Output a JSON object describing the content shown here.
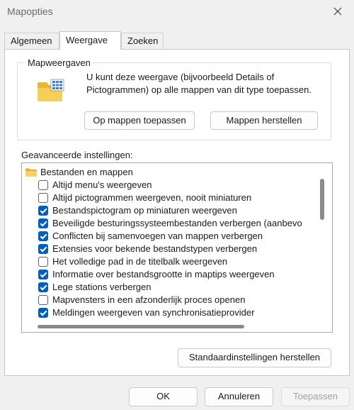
{
  "window": {
    "title": "Mapopties"
  },
  "tabs": [
    {
      "label": "Algemeen",
      "active": false
    },
    {
      "label": "Weergave",
      "active": true
    },
    {
      "label": "Zoeken",
      "active": false
    }
  ],
  "folder_views": {
    "title": "Mapweergaven",
    "description": "U kunt deze weergave (bijvoorbeeld Details of Pictogrammen) op alle mappen van dit type toepassen.",
    "apply_label": "Op mappen toepassen",
    "reset_label": "Mappen herstellen",
    "icon": "folder-icon"
  },
  "advanced": {
    "label": "Geavanceerde instellingen:",
    "root": {
      "label": "Bestanden en mappen",
      "icon": "folder-icon"
    },
    "items": [
      {
        "label": "Altijd menu's weergeven",
        "checked": false
      },
      {
        "label": "Altijd pictogrammen weergeven, nooit miniaturen",
        "checked": false
      },
      {
        "label": "Bestandspictogram op miniaturen weergeven",
        "checked": true
      },
      {
        "label": "Beveiligde besturingssysteembestanden verbergen (aanbevo",
        "checked": true
      },
      {
        "label": "Conflicten bij samenvoegen van mappen verbergen",
        "checked": true
      },
      {
        "label": "Extensies voor bekende bestandstypen verbergen",
        "checked": true
      },
      {
        "label": "Het volledige pad in de titelbalk weergeven",
        "checked": false
      },
      {
        "label": "Informatie over bestandsgrootte in maptips weergeven",
        "checked": true
      },
      {
        "label": "Lege stations verbergen",
        "checked": true
      },
      {
        "label": "Mapvensters in een afzonderlijk proces openen",
        "checked": false
      },
      {
        "label": "Meldingen weergeven van synchronisatieprovider",
        "checked": true
      }
    ],
    "defaults_label": "Standaardinstellingen herstellen"
  },
  "footer": {
    "ok_label": "OK",
    "cancel_label": "Annuleren",
    "apply_label": "Toepassen"
  },
  "colors": {
    "accent": "#005fb8",
    "window_bg": "#f0f0f0",
    "panel_bg": "#ffffff"
  }
}
